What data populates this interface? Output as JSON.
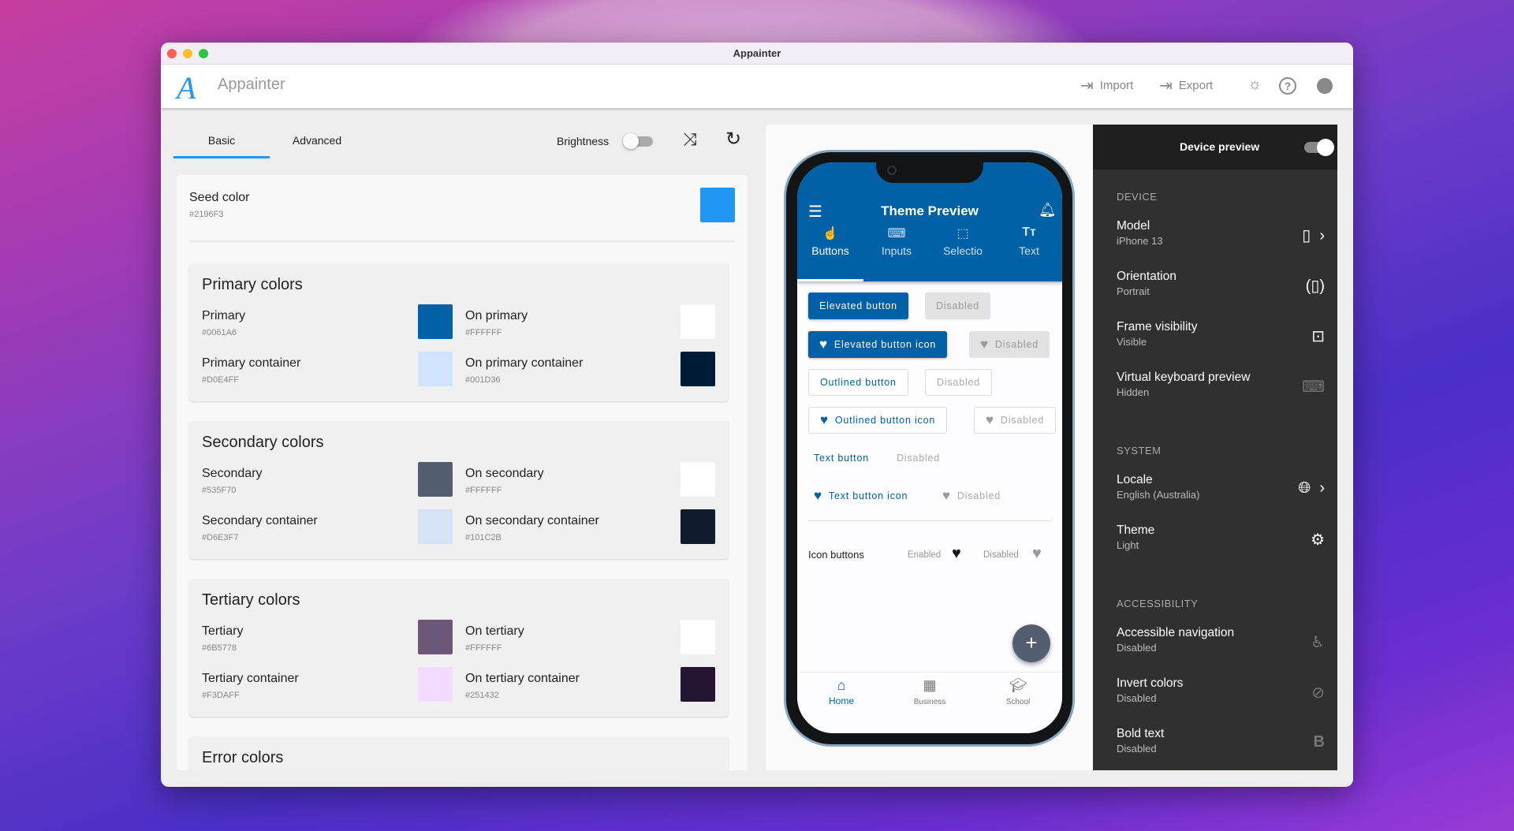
{
  "window": {
    "title": "Appainter"
  },
  "header": {
    "app_name": "Appainter",
    "import_label": "Import",
    "export_label": "Export"
  },
  "editor": {
    "tabs": [
      {
        "label": "Basic",
        "active": true
      },
      {
        "label": "Advanced",
        "active": false
      }
    ],
    "brightness_label": "Brightness",
    "brightness_on": false,
    "seed": {
      "label": "Seed color",
      "hex": "#2196F3",
      "color": "#2196F3"
    },
    "groups": [
      {
        "title": "Primary colors",
        "rows": [
          [
            {
              "label": "Primary",
              "hex": "#0061A6"
            },
            {
              "label": "On primary",
              "hex": "#FFFFFF"
            }
          ],
          [
            {
              "label": "Primary container",
              "hex": "#D0E4FF"
            },
            {
              "label": "On primary container",
              "hex": "#001D36"
            }
          ]
        ]
      },
      {
        "title": "Secondary colors",
        "rows": [
          [
            {
              "label": "Secondary",
              "hex": "#535F70"
            },
            {
              "label": "On secondary",
              "hex": "#FFFFFF"
            }
          ],
          [
            {
              "label": "Secondary container",
              "hex": "#D6E3F7"
            },
            {
              "label": "On secondary container",
              "hex": "#101C2B"
            }
          ]
        ]
      },
      {
        "title": "Tertiary colors",
        "rows": [
          [
            {
              "label": "Tertiary",
              "hex": "#6B5778"
            },
            {
              "label": "On tertiary",
              "hex": "#FFFFFF"
            }
          ],
          [
            {
              "label": "Tertiary container",
              "hex": "#F3DAFF"
            },
            {
              "label": "On tertiary container",
              "hex": "#251432"
            }
          ]
        ]
      },
      {
        "title": "Error colors",
        "rows": []
      }
    ]
  },
  "preview": {
    "app_title": "Theme Preview",
    "tabs": [
      {
        "label": "Buttons",
        "icon": "touch-icon"
      },
      {
        "label": "Inputs",
        "icon": "keyboard-icon"
      },
      {
        "label": "Selectio",
        "icon": "select-icon"
      },
      {
        "label": "Text",
        "icon": "text-fields-icon"
      }
    ],
    "buttons": {
      "elevated": "Elevated button",
      "elevated_icon": "Elevated button icon",
      "outlined": "Outlined button",
      "outlined_icon": "Outlined button icon",
      "text": "Text button",
      "text_icon": "Text button icon",
      "disabled": "Disabled"
    },
    "icon_buttons": {
      "label": "Icon buttons",
      "enabled": "Enabled",
      "disabled": "Disabled"
    },
    "nav": [
      {
        "label": "Home",
        "active": true
      },
      {
        "label": "Business"
      },
      {
        "label": "School"
      }
    ],
    "primary": "#0061A6"
  },
  "device_panel": {
    "title": "Device preview",
    "enabled": true,
    "sections": [
      {
        "title": "DEVICE",
        "items": [
          {
            "label": "Model",
            "value": "iPhone 13",
            "icon": "apple-phone-chevron"
          },
          {
            "label": "Orientation",
            "value": "Portrait",
            "icon": "screen-rotation-icon"
          },
          {
            "label": "Frame visibility",
            "value": "Visible",
            "icon": "frame-icon"
          },
          {
            "label": "Virtual keyboard preview",
            "value": "Hidden",
            "icon": "keyboard-icon"
          }
        ]
      },
      {
        "title": "SYSTEM",
        "items": [
          {
            "label": "Locale",
            "value": "English (Australia)",
            "icon": "globe-chevron"
          },
          {
            "label": "Theme",
            "value": "Light",
            "icon": "brightness-icon"
          }
        ]
      },
      {
        "title": "ACCESSIBILITY",
        "items": [
          {
            "label": "Accessible navigation",
            "value": "Disabled",
            "icon": "accessible-icon"
          },
          {
            "label": "Invert colors",
            "value": "Disabled",
            "icon": "invert-colors-off-icon"
          },
          {
            "label": "Bold text",
            "value": "Disabled",
            "icon": "bold-icon"
          }
        ]
      }
    ]
  }
}
